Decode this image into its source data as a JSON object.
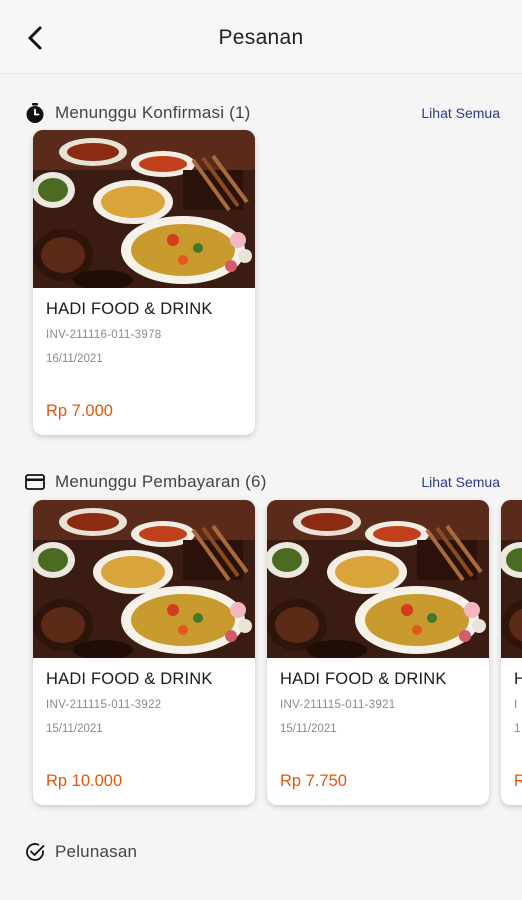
{
  "header": {
    "title": "Pesanan",
    "back_icon": "arrow-back-icon"
  },
  "sections": [
    {
      "title": "Menunggu Konfirmasi (1)",
      "icon": "stopwatch-icon",
      "see_all": "Lihat Semua",
      "orders": [
        {
          "store": "HADI FOOD & DRINK",
          "invoice": "INV-211116-011-3978",
          "date": "16/11/2021",
          "price": "Rp 7.000"
        }
      ]
    },
    {
      "title": "Menunggu Pembayaran (6)",
      "icon": "credit-card-icon",
      "see_all": "Lihat Semua",
      "orders": [
        {
          "store": "HADI FOOD & DRINK",
          "invoice": "INV-211115-011-3922",
          "date": "15/11/2021",
          "price": "Rp 10.000"
        },
        {
          "store": "HADI FOOD & DRINK",
          "invoice": "INV-211115-011-3921",
          "date": "15/11/2021",
          "price": "Rp 7.750"
        },
        {
          "store": "H",
          "invoice": "I",
          "date": "1",
          "price": "R"
        }
      ]
    },
    {
      "title": "Pelunasan",
      "icon": "check-circle-icon"
    }
  ],
  "colors": {
    "price": "#e2570f",
    "link": "#2b3a8c",
    "background": "#f5f5f5"
  }
}
